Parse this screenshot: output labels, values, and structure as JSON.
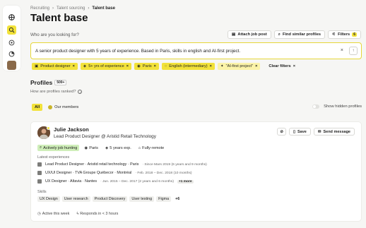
{
  "breadcrumb": [
    "Recruiting",
    "Talent sourcing",
    "Talent base"
  ],
  "page_title": "Talent base",
  "question": "Who are you looking for?",
  "top_buttons": {
    "attach": "Attach job post",
    "similar": "Find similar profiles",
    "filters": "Filters",
    "filters_count": "6"
  },
  "search": {
    "value": "A senior product designer with 5 years of experience. Based in Paris, skills in english and AI-first project."
  },
  "filter_chips": [
    "Product designer",
    "5+ yrs of experience",
    "Paris",
    "English (intermediary)",
    "\"AI-first project\""
  ],
  "clear_filters": "Clear filters",
  "profiles": {
    "title": "Profiles",
    "count": "500+",
    "ranked_question": "How are profiles ranked?"
  },
  "tabs": {
    "all": "All",
    "members": "Our members"
  },
  "show_hidden": "Show hidden profiles",
  "candidate": {
    "name": "Julie Jackson",
    "title": "Lead Product Designer @ Aristid Retail Technology",
    "actions": {
      "save": "Save",
      "send": "Send message"
    },
    "tags": [
      "Actively job hunting",
      "Paris",
      "5 years exp.",
      "Fully-remote"
    ],
    "experiences_label": "Latest experiences",
    "experiences": [
      {
        "role": "Lead Product Designer · Aristid retail technology · Paris",
        "meta": "· Since Mars 2019 (6 years and 9 months)"
      },
      {
        "role": "UX/UI Designer · TVA Groupe Québecor · Montréal",
        "meta": "· Feb. 2018 – Dec. 2018 (10 months)"
      },
      {
        "role": "UX Designer · Altavia · Nantes",
        "meta": "· Jun. 2015 – Dec. 2017 (2 years and 6 months)",
        "more": "+1 more"
      }
    ],
    "skills_label": "Skills",
    "skills": [
      "UX Design",
      "User research",
      "Product Discovery",
      "User testing",
      "Figma"
    ],
    "skills_more": "+6",
    "footer": {
      "active": "Active this week",
      "responds": "Responds in < 3 hours"
    }
  },
  "colors": {
    "accent": "#f2e23a",
    "green": "#cfeeb9"
  }
}
